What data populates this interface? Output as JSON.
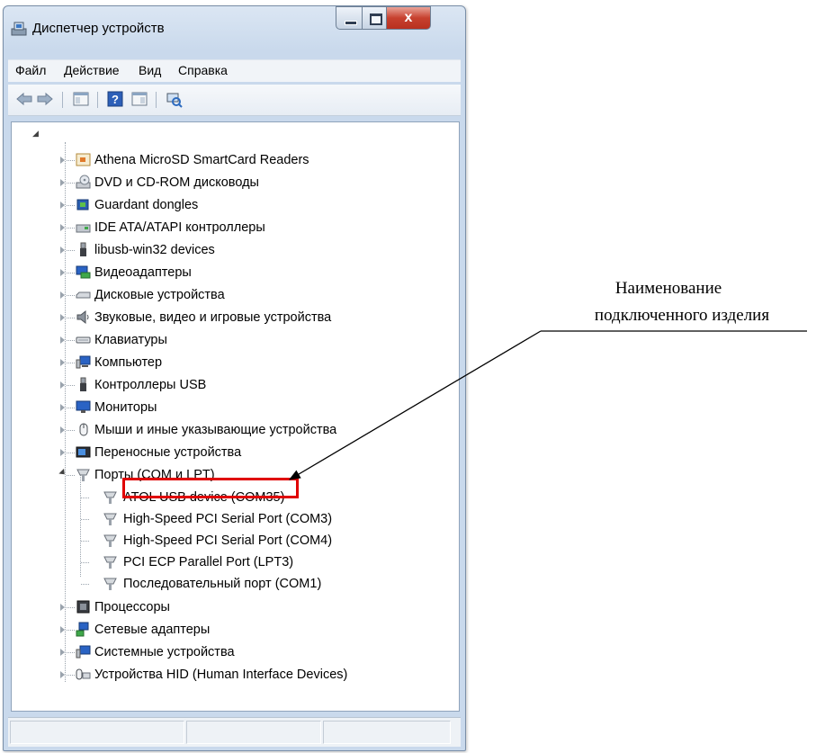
{
  "window": {
    "title": "Диспетчер устройств",
    "close_glyph": "x"
  },
  "menu": [
    "Файл",
    "Действие",
    "Вид",
    "Справка"
  ],
  "toolbar": {
    "icons": [
      "back-icon",
      "forward-icon",
      "console-tree-icon",
      "help-icon",
      "properties-icon",
      "scan-hardware-icon"
    ]
  },
  "tree": {
    "root_expander": "◢",
    "categories": [
      {
        "label": "Athena MicroSD SmartCard Readers",
        "icon": "smartcard-reader-icon"
      },
      {
        "label": "DVD и CD-ROM дисководы",
        "icon": "dvd-drive-icon"
      },
      {
        "label": "Guardant dongles",
        "icon": "dongle-icon"
      },
      {
        "label": "IDE ATA/ATAPI контроллеры",
        "icon": "ide-controller-icon"
      },
      {
        "label": "libusb-win32 devices",
        "icon": "usb-plug-icon"
      },
      {
        "label": "Видеоадаптеры",
        "icon": "display-adapter-icon"
      },
      {
        "label": "Дисковые устройства",
        "icon": "disk-drive-icon"
      },
      {
        "label": "Звуковые, видео и игровые устройства",
        "icon": "speaker-icon"
      },
      {
        "label": "Клавиатуры",
        "icon": "keyboard-icon"
      },
      {
        "label": "Компьютер",
        "icon": "computer-icon"
      },
      {
        "label": "Контроллеры USB",
        "icon": "usb-controller-icon"
      },
      {
        "label": "Мониторы",
        "icon": "monitor-icon"
      },
      {
        "label": "Мыши и иные указывающие устройства",
        "icon": "mouse-icon"
      },
      {
        "label": "Переносные устройства",
        "icon": "portable-device-icon"
      },
      {
        "label": "Порты (COM и LPT)",
        "icon": "port-icon",
        "expanded": true
      },
      {
        "label": "Процессоры",
        "icon": "processor-icon"
      },
      {
        "label": "Сетевые адаптеры",
        "icon": "network-adapter-icon"
      },
      {
        "label": "Системные устройства",
        "icon": "system-device-icon"
      },
      {
        "label": "Устройства HID (Human Interface Devices)",
        "icon": "hid-icon"
      }
    ],
    "ports_children": [
      "ATOL USB device (COM35)",
      "High-Speed PCI Serial Port (COM3)",
      "High-Speed PCI Serial Port (COM4)",
      "PCI ECP Parallel Port (LPT3)",
      "Последовательный порт (COM1)"
    ]
  },
  "annotation": {
    "line1": "Наименование",
    "line2": "подключенного изделия",
    "highlight_color": "#e00000"
  }
}
